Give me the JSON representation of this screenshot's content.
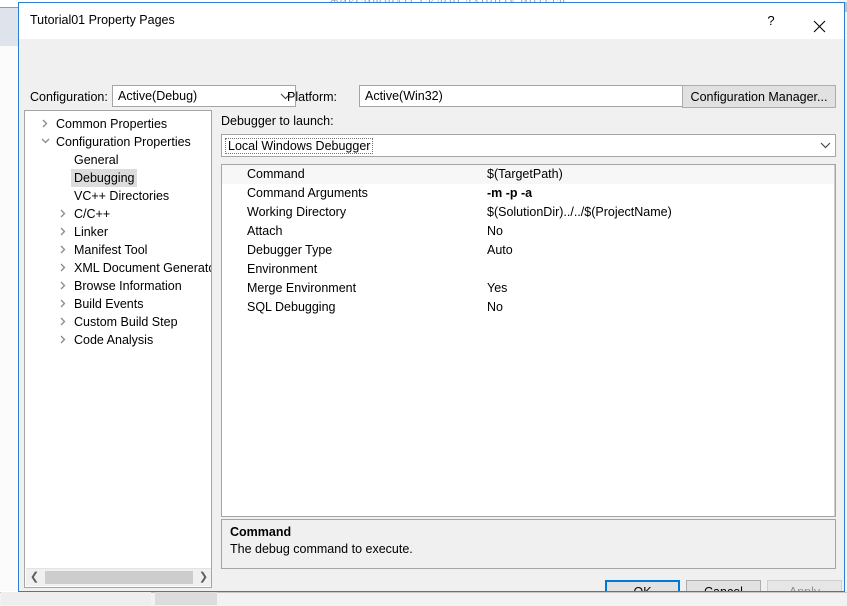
{
  "window": {
    "title": "Tutorial01 Property Pages",
    "help_button": "?",
    "close_icon": "close-icon"
  },
  "toolbar": {
    "configuration_label": "Configuration:",
    "configuration_value": "Active(Debug)",
    "platform_label": "Platform:",
    "platform_value": "Active(Win32)",
    "configuration_manager_label": "Configuration Manager..."
  },
  "tree": {
    "items": [
      {
        "label": "Common Properties",
        "level": 0,
        "arrow": "collapsed",
        "selected": false
      },
      {
        "label": "Configuration Properties",
        "level": 0,
        "arrow": "expanded",
        "selected": false
      },
      {
        "label": "General",
        "level": 1,
        "arrow": "none",
        "selected": false
      },
      {
        "label": "Debugging",
        "level": 1,
        "arrow": "none",
        "selected": true
      },
      {
        "label": "VC++ Directories",
        "level": 1,
        "arrow": "none",
        "selected": false
      },
      {
        "label": "C/C++",
        "level": 1,
        "arrow": "collapsed",
        "selected": false
      },
      {
        "label": "Linker",
        "level": 1,
        "arrow": "collapsed",
        "selected": false
      },
      {
        "label": "Manifest Tool",
        "level": 1,
        "arrow": "collapsed",
        "selected": false
      },
      {
        "label": "XML Document Generator",
        "level": 1,
        "arrow": "collapsed",
        "selected": false
      },
      {
        "label": "Browse Information",
        "level": 1,
        "arrow": "collapsed",
        "selected": false
      },
      {
        "label": "Build Events",
        "level": 1,
        "arrow": "collapsed",
        "selected": false
      },
      {
        "label": "Custom Build Step",
        "level": 1,
        "arrow": "collapsed",
        "selected": false
      },
      {
        "label": "Code Analysis",
        "level": 1,
        "arrow": "collapsed",
        "selected": false
      }
    ],
    "scrollbar": {
      "left_arrow": "❮",
      "right_arrow": "❯"
    }
  },
  "main": {
    "debugger_label": "Debugger to launch:",
    "debugger_value": "Local Windows Debugger",
    "properties": [
      {
        "name": "Command",
        "value": "$(TargetPath)",
        "bold": false,
        "highlight": true
      },
      {
        "name": "Command Arguments",
        "value": "-m -p -a",
        "bold": true,
        "highlight": false
      },
      {
        "name": "Working Directory",
        "value": "$(SolutionDir)../../$(ProjectName)",
        "bold": false,
        "highlight": false
      },
      {
        "name": "Attach",
        "value": "No",
        "bold": false,
        "highlight": false
      },
      {
        "name": "Debugger Type",
        "value": "Auto",
        "bold": false,
        "highlight": false
      },
      {
        "name": "Environment",
        "value": "",
        "bold": false,
        "highlight": false
      },
      {
        "name": "Merge Environment",
        "value": "Yes",
        "bold": false,
        "highlight": false
      },
      {
        "name": "SQL Debugging",
        "value": "No",
        "bold": false,
        "highlight": false
      }
    ],
    "description": {
      "title": "Command",
      "body": "The debug command to execute."
    }
  },
  "footer": {
    "ok_label": "OK",
    "cancel_label": "Cancel",
    "apply_label": "Apply"
  },
  "backdrop": {
    "ghost_text": "ФИКСИРОВАТЬ  СКЛОН  ДАННЫХ  ИНТЕГР"
  },
  "colors": {
    "dialog_border": "#2a7fd4",
    "focus_blue": "#0078d7",
    "dialog_bg": "#f0f0f0",
    "field_bg": "#ffffff",
    "selection_gray": "#dcdcdc",
    "disabled_text": "#919191"
  }
}
